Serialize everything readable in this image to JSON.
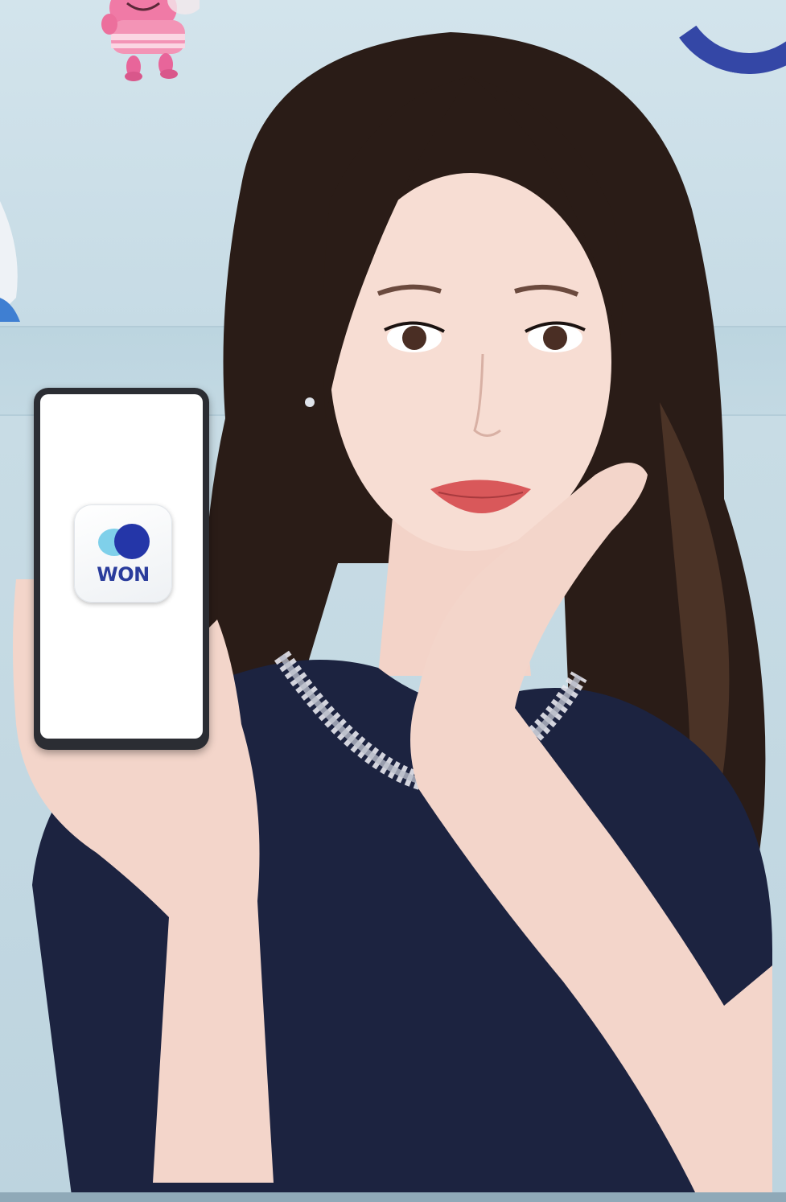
{
  "app_icon": {
    "label": "WON",
    "icon": "won-app-icon",
    "colors": {
      "dark_circle": "#2436a8",
      "light_circle": "#7fd0ea",
      "text": "#2a3c9c"
    }
  },
  "colors": {
    "background": "#c9dde6",
    "accent_arc": "#3447a6",
    "top_wear": "#1c2340"
  }
}
